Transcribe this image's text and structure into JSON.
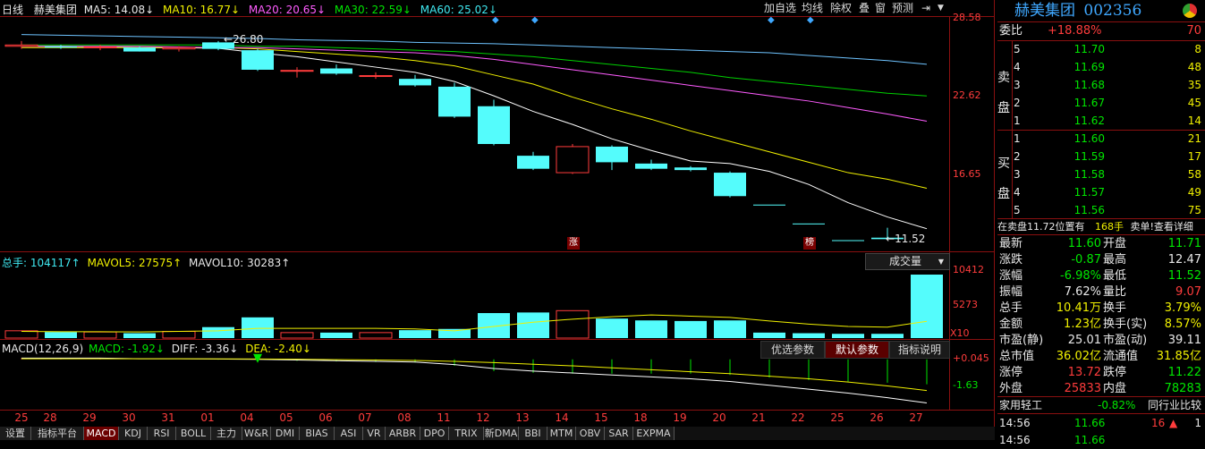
{
  "main_header": {
    "period": "日线",
    "stock_name": "赫美集团",
    "ma5": "MA5: 14.08↓",
    "ma10": "MA10: 16.77↓",
    "ma20": "MA20: 20.65↓",
    "ma30": "MA30: 22.59↓",
    "ma60": "MA60: 25.02↓"
  },
  "toolbar": [
    "加自选",
    "均线",
    "除权",
    "叠",
    "窗",
    "预测"
  ],
  "toolbar_icons": {
    "expand": "⇥",
    "dropdown": "▼"
  },
  "price_axis": [
    "28.58",
    "22.62",
    "16.65"
  ],
  "price_annotations": {
    "high": "26.80",
    "low": "11.52",
    "badge_limit": "涨",
    "badge_list": "榜"
  },
  "volume_header": {
    "total": "总手: 104117↑",
    "mavol5": "MAVOL5: 27575↑",
    "mavol10": "MAVOL10: 30283↑",
    "selector": "成交量",
    "selector_icon": "▼"
  },
  "volume_axis": [
    "10412",
    "5273"
  ],
  "volume_unit": "X10",
  "macd_header": {
    "name": "MACD(12,26,9)",
    "macd": "MACD: -1.92↓",
    "diff": "DIFF: -3.36↓",
    "dea": "DEA: -2.40↓"
  },
  "macd_buttons": [
    "优选参数",
    "默认参数",
    "指标说明"
  ],
  "macd_axis": [
    "+0.045",
    "-1.63"
  ],
  "x_dates": [
    "25",
    "28",
    "29",
    "30",
    "31",
    "01",
    "04",
    "05",
    "06",
    "07",
    "08",
    "11",
    "12",
    "13",
    "14",
    "15",
    "18",
    "19",
    "20",
    "21",
    "22",
    "25",
    "26",
    "27"
  ],
  "bottom_tabs": [
    "设置",
    "指标平台",
    "MACD",
    "KDJ",
    "RSI",
    "BOLL",
    "主力",
    "W&R",
    "DMI",
    "BIAS",
    "ASI",
    "VR",
    "ARBR",
    "DPO",
    "TRIX",
    "新DMA",
    "BBI",
    "MTM",
    "OBV",
    "SAR",
    "EXPMA"
  ],
  "quote": {
    "title": "赫美集团",
    "code": "002356",
    "weibi_label": "委比",
    "weibi": "+18.88%",
    "weibi_diff": "70",
    "sell_label": [
      "卖",
      "盘"
    ],
    "buy_label": [
      "买",
      "盘"
    ],
    "sell": [
      {
        "level": "5",
        "price": "11.70",
        "vol": "8"
      },
      {
        "level": "4",
        "price": "11.69",
        "vol": "48"
      },
      {
        "level": "3",
        "price": "11.68",
        "vol": "35"
      },
      {
        "level": "2",
        "price": "11.67",
        "vol": "45"
      },
      {
        "level": "1",
        "price": "11.62",
        "vol": "14"
      }
    ],
    "buy": [
      {
        "level": "1",
        "price": "11.60",
        "vol": "21"
      },
      {
        "level": "2",
        "price": "11.59",
        "vol": "17"
      },
      {
        "level": "3",
        "price": "11.58",
        "vol": "58"
      },
      {
        "level": "4",
        "price": "11.57",
        "vol": "49"
      },
      {
        "level": "5",
        "price": "11.56",
        "vol": "75"
      }
    ],
    "notice": "在卖盘11.72位置有",
    "notice_vol": "168手",
    "notice_tail": "卖单!",
    "notice_link": "查看详细",
    "stats": [
      {
        "l1": "最新",
        "v1": "11.60",
        "c1": "green",
        "l2": "开盘",
        "v2": "11.71",
        "c2": "green"
      },
      {
        "l1": "涨跌",
        "v1": "-0.87",
        "c1": "green",
        "l2": "最高",
        "v2": "12.47",
        "c2": "white"
      },
      {
        "l1": "涨幅",
        "v1": "-6.98%",
        "c1": "green",
        "l2": "最低",
        "v2": "11.52",
        "c2": "green"
      },
      {
        "l1": "振幅",
        "v1": "7.62%",
        "c1": "white",
        "l2": "量比",
        "v2": "9.07",
        "c2": "red"
      },
      {
        "l1": "总手",
        "v1": "10.41万",
        "c1": "yellow",
        "l2": "换手",
        "v2": "3.79%",
        "c2": "yellow"
      },
      {
        "l1": "金额",
        "v1": "1.23亿",
        "c1": "yellow",
        "l2": "换手(实)",
        "v2": "8.57%",
        "c2": "yellow"
      },
      {
        "l1": "市盈(静)",
        "v1": "25.01",
        "c1": "white",
        "l2": "市盈(动)",
        "v2": "39.11",
        "c2": "white"
      },
      {
        "l1": "总市值",
        "v1": "36.02亿",
        "c1": "yellow",
        "l2": "流通值",
        "v2": "31.85亿",
        "c2": "yellow"
      },
      {
        "l1": "涨停",
        "v1": "13.72",
        "c1": "red",
        "l2": "跌停",
        "v2": "11.22",
        "c2": "green"
      },
      {
        "l1": "外盘",
        "v1": "25833",
        "c1": "red",
        "l2": "内盘",
        "v2": "78283",
        "c2": "green"
      }
    ],
    "industry": "家用轻工",
    "industry_chg": "-0.82%",
    "industry_link": "同行业比较",
    "ticks": [
      {
        "time": "14:56",
        "price": "11.66",
        "vol": "16",
        "arrow": "▲",
        "flag": "1"
      },
      {
        "time": "14:56",
        "price": "11.66",
        "vol": "",
        "arrow": "",
        "flag": ""
      }
    ]
  },
  "colors": {
    "up": "#ff3c3c",
    "down": "#00e600",
    "bear_candle": "#54fcfc",
    "panel_border": "#8a1010"
  },
  "chart_data": {
    "type": "candlestick",
    "dates": [
      "25",
      "28",
      "29",
      "30",
      "31",
      "01",
      "04",
      "05",
      "06",
      "07",
      "08",
      "11",
      "12",
      "13",
      "14",
      "15",
      "18",
      "19",
      "20",
      "21",
      "22",
      "25",
      "26",
      "27"
    ],
    "candles": [
      {
        "o": 26.4,
        "h": 26.8,
        "l": 26.2,
        "c": 26.5,
        "up": true
      },
      {
        "o": 26.4,
        "h": 26.5,
        "l": 26.2,
        "c": 26.3,
        "up": false
      },
      {
        "o": 26.35,
        "h": 26.5,
        "l": 26.1,
        "c": 26.3,
        "up": true
      },
      {
        "o": 26.3,
        "h": 26.4,
        "l": 26.0,
        "c": 26.0,
        "up": false
      },
      {
        "o": 26.2,
        "h": 26.4,
        "l": 26.0,
        "c": 26.3,
        "up": true
      },
      {
        "o": 26.7,
        "h": 26.8,
        "l": 26.1,
        "c": 26.2,
        "up": false
      },
      {
        "o": 26.1,
        "h": 26.2,
        "l": 24.5,
        "c": 24.6,
        "up": false
      },
      {
        "o": 24.5,
        "h": 24.8,
        "l": 24.0,
        "c": 24.55,
        "up": true
      },
      {
        "o": 24.7,
        "h": 25.0,
        "l": 24.2,
        "c": 24.3,
        "up": false
      },
      {
        "o": 24.1,
        "h": 24.4,
        "l": 23.9,
        "c": 24.15,
        "up": true
      },
      {
        "o": 23.9,
        "h": 24.2,
        "l": 23.3,
        "c": 23.4,
        "up": false
      },
      {
        "o": 23.3,
        "h": 23.6,
        "l": 20.9,
        "c": 21.0,
        "up": false
      },
      {
        "o": 21.8,
        "h": 22.3,
        "l": 18.8,
        "c": 18.9,
        "up": false
      },
      {
        "o": 18.0,
        "h": 18.3,
        "l": 16.9,
        "c": 17.0,
        "up": false
      },
      {
        "o": 16.7,
        "h": 18.9,
        "l": 16.6,
        "c": 18.7,
        "up": true
      },
      {
        "o": 18.7,
        "h": 18.8,
        "l": 16.9,
        "c": 17.5,
        "up": false
      },
      {
        "o": 17.4,
        "h": 17.7,
        "l": 16.9,
        "c": 17.0,
        "up": false
      },
      {
        "o": 17.1,
        "h": 17.2,
        "l": 16.8,
        "c": 16.9,
        "up": false
      },
      {
        "o": 16.7,
        "h": 16.8,
        "l": 14.8,
        "c": 14.9,
        "up": false
      },
      {
        "o": 14.25,
        "h": 14.25,
        "l": 14.25,
        "c": 14.25,
        "up": false
      },
      {
        "o": 12.8,
        "h": 12.8,
        "l": 12.8,
        "c": 12.8,
        "up": false
      },
      {
        "o": 11.52,
        "h": 11.52,
        "l": 11.52,
        "c": 11.52,
        "up": false
      },
      {
        "o": 11.71,
        "h": 12.47,
        "l": 11.52,
        "c": 11.6,
        "up": false
      }
    ],
    "ma_series": [
      {
        "name": "MA5",
        "color": "#ffffff",
        "values": [
          26.4,
          26.4,
          26.35,
          26.3,
          26.3,
          26.25,
          25.9,
          25.6,
          25.2,
          24.8,
          24.4,
          23.7,
          22.6,
          21.4,
          20.4,
          19.3,
          18.4,
          17.6,
          17.4,
          16.8,
          15.8,
          14.4,
          13.3,
          12.4
        ]
      },
      {
        "name": "MA10",
        "color": "#f0f000",
        "values": [
          26.3,
          26.3,
          26.3,
          26.3,
          26.3,
          26.3,
          26.2,
          26.0,
          25.8,
          25.6,
          25.3,
          24.9,
          24.2,
          23.5,
          22.5,
          21.6,
          20.8,
          19.9,
          19.1,
          18.3,
          17.5,
          16.7,
          16.2,
          15.5
        ]
      },
      {
        "name": "MA20",
        "color": "#ff5cff",
        "values": [
          26.4,
          26.4,
          26.4,
          26.4,
          26.35,
          26.3,
          26.3,
          26.2,
          26.1,
          26.0,
          25.9,
          25.7,
          25.4,
          25.0,
          24.6,
          24.2,
          23.8,
          23.4,
          23.0,
          22.6,
          22.2,
          21.7,
          21.2,
          20.65
        ]
      },
      {
        "name": "MA30",
        "color": "#00d000",
        "values": [
          26.5,
          26.5,
          26.5,
          26.5,
          26.5,
          26.5,
          26.4,
          26.4,
          26.3,
          26.2,
          26.1,
          26.0,
          25.8,
          25.6,
          25.3,
          25.0,
          24.7,
          24.4,
          24.0,
          23.7,
          23.4,
          23.1,
          22.8,
          22.59
        ]
      },
      {
        "name": "MA60",
        "color": "#6ec3ff",
        "values": [
          27.3,
          27.25,
          27.2,
          27.15,
          27.1,
          27.05,
          27.0,
          26.9,
          26.85,
          26.8,
          26.7,
          26.65,
          26.6,
          26.5,
          26.4,
          26.3,
          26.2,
          26.1,
          26.0,
          25.9,
          25.7,
          25.5,
          25.3,
          25.02
        ]
      }
    ],
    "price_range": [
      10.8,
      28.58
    ],
    "volume": [
      1200,
      1000,
      1000,
      800,
      1100,
      1800,
      3400,
      900,
      900,
      900,
      1300,
      1500,
      4100,
      4200,
      4500,
      3200,
      2900,
      2800,
      2900,
      900,
      800,
      700,
      700,
      10412
    ],
    "volume_up": [
      true,
      false,
      true,
      false,
      true,
      false,
      false,
      true,
      false,
      true,
      false,
      false,
      false,
      false,
      true,
      false,
      false,
      false,
      false,
      false,
      false,
      false,
      false,
      false
    ],
    "mavol5": [
      1100,
      1050,
      1050,
      1000,
      1100,
      1200,
      1600,
      1600,
      1600,
      1600,
      1500,
      1200,
      1900,
      2600,
      3100,
      3500,
      3800,
      3600,
      3400,
      2800,
      2300,
      1900,
      1800,
      2757
    ],
    "volume_range": [
      0,
      11000
    ],
    "macd_diff": [
      0.1,
      0.1,
      0.1,
      0.05,
      0.05,
      0.03,
      0.0,
      -0.05,
      -0.1,
      -0.15,
      -0.2,
      -0.4,
      -0.7,
      -0.9,
      -1.05,
      -1.2,
      -1.35,
      -1.5,
      -1.7,
      -2.0,
      -2.3,
      -2.6,
      -2.95,
      -3.36
    ],
    "macd_dea": [
      0.05,
      0.05,
      0.05,
      0.05,
      0.05,
      0.04,
      0.03,
      0.01,
      -0.02,
      -0.05,
      -0.08,
      -0.15,
      -0.25,
      -0.38,
      -0.5,
      -0.65,
      -0.8,
      -0.95,
      -1.1,
      -1.3,
      -1.5,
      -1.75,
      -2.05,
      -2.4
    ],
    "macd_hist": [
      0.1,
      0.1,
      0.1,
      0.0,
      0.0,
      -0.02,
      -0.06,
      -0.12,
      -0.16,
      -0.2,
      -0.24,
      -0.5,
      -0.9,
      -1.04,
      -1.1,
      -1.1,
      -1.1,
      -1.1,
      -1.2,
      -1.4,
      -1.6,
      -1.7,
      -1.8,
      -1.92
    ],
    "macd_range": [
      -3.6,
      0.4
    ]
  }
}
